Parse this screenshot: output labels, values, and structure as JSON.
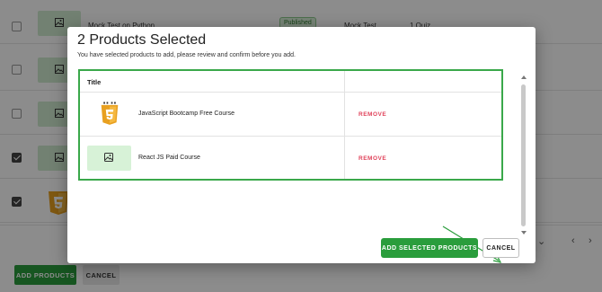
{
  "background_page": {
    "rows": [
      {
        "checked": false,
        "title": "Mock Test on Python",
        "status": "Published",
        "type": "Mock Test",
        "content": "1 Quiz",
        "thumb": "placeholder"
      },
      {
        "checked": false,
        "thumb": "placeholder"
      },
      {
        "checked": false,
        "thumb": "placeholder"
      },
      {
        "checked": true,
        "thumb": "placeholder"
      },
      {
        "checked": true,
        "thumb": "html5-logo"
      }
    ],
    "footer": {
      "add_button": "ADD PRODUCTS",
      "cancel_button": "CANCEL",
      "pager_chevron_down": "chevron-down-icon",
      "pager_prev": "chevron-left-icon",
      "pager_next": "chevron-right-icon"
    }
  },
  "modal": {
    "title": "2 Products Selected",
    "subtitle": "You have selected products to add, please review and confirm before you add.",
    "table": {
      "header_title": "Title",
      "rows": [
        {
          "title": "JavaScript Bootcamp Free Course",
          "action": "REMOVE",
          "thumb": "html5-logo"
        },
        {
          "title": "React JS Paid Course",
          "action": "REMOVE",
          "thumb": "image-placeholder"
        }
      ]
    },
    "primary_button": "ADD SELECTED PRODUCTS",
    "cancel_button": "CANCEL"
  },
  "colors": {
    "accent_green": "#2a9d3c",
    "highlight_green": "#3aa84a",
    "remove_red": "#e0425a",
    "thumb_green": "#d7f2d7"
  }
}
